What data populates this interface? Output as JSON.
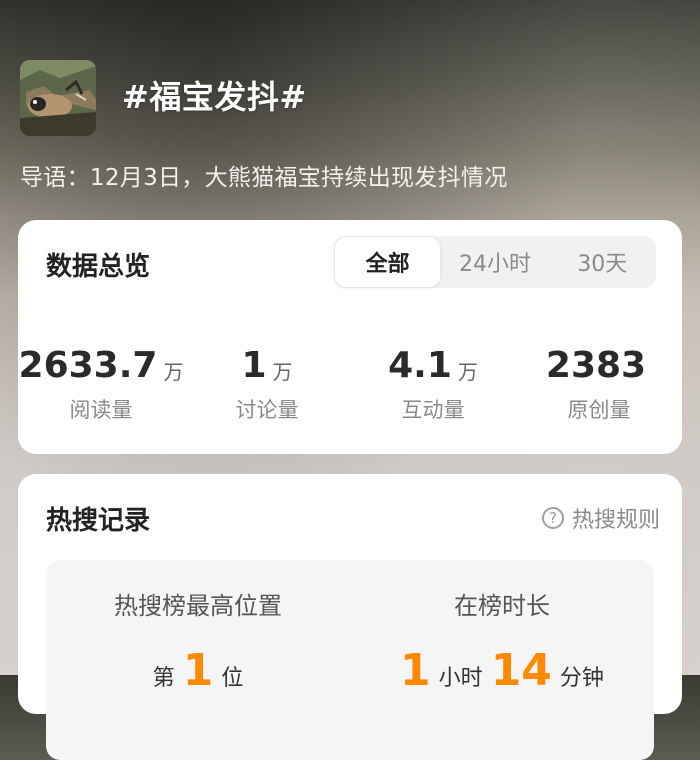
{
  "header": {
    "title": "#福宝发抖#",
    "guide": "导语：12月3日，大熊猫福宝持续出现发抖情况"
  },
  "overview": {
    "title": "数据总览",
    "tabs": [
      "全部",
      "24小时",
      "30天"
    ],
    "active_tab": "全部",
    "stats": [
      {
        "value": "2633.7",
        "unit": "万",
        "label": "阅读量"
      },
      {
        "value": "1",
        "unit": "万",
        "label": "讨论量"
      },
      {
        "value": "4.1",
        "unit": "万",
        "label": "互动量"
      },
      {
        "value": "2383",
        "unit": "",
        "label": "原创量"
      }
    ]
  },
  "hot": {
    "title": "热搜记录",
    "rules_label": "热搜规则",
    "help_glyph": "?",
    "left_title": "热搜榜最高位置",
    "left_prefix": "第",
    "left_value": "1",
    "left_suffix": "位",
    "right_title": "在榜时长",
    "right_hours": "1",
    "right_hours_label": "小时",
    "right_minutes": "14",
    "right_minutes_label": "分钟"
  },
  "colors": {
    "accent": "#ff8a00",
    "card_bg": "#ffffff"
  },
  "icons": {
    "help": "question-circle-icon"
  }
}
